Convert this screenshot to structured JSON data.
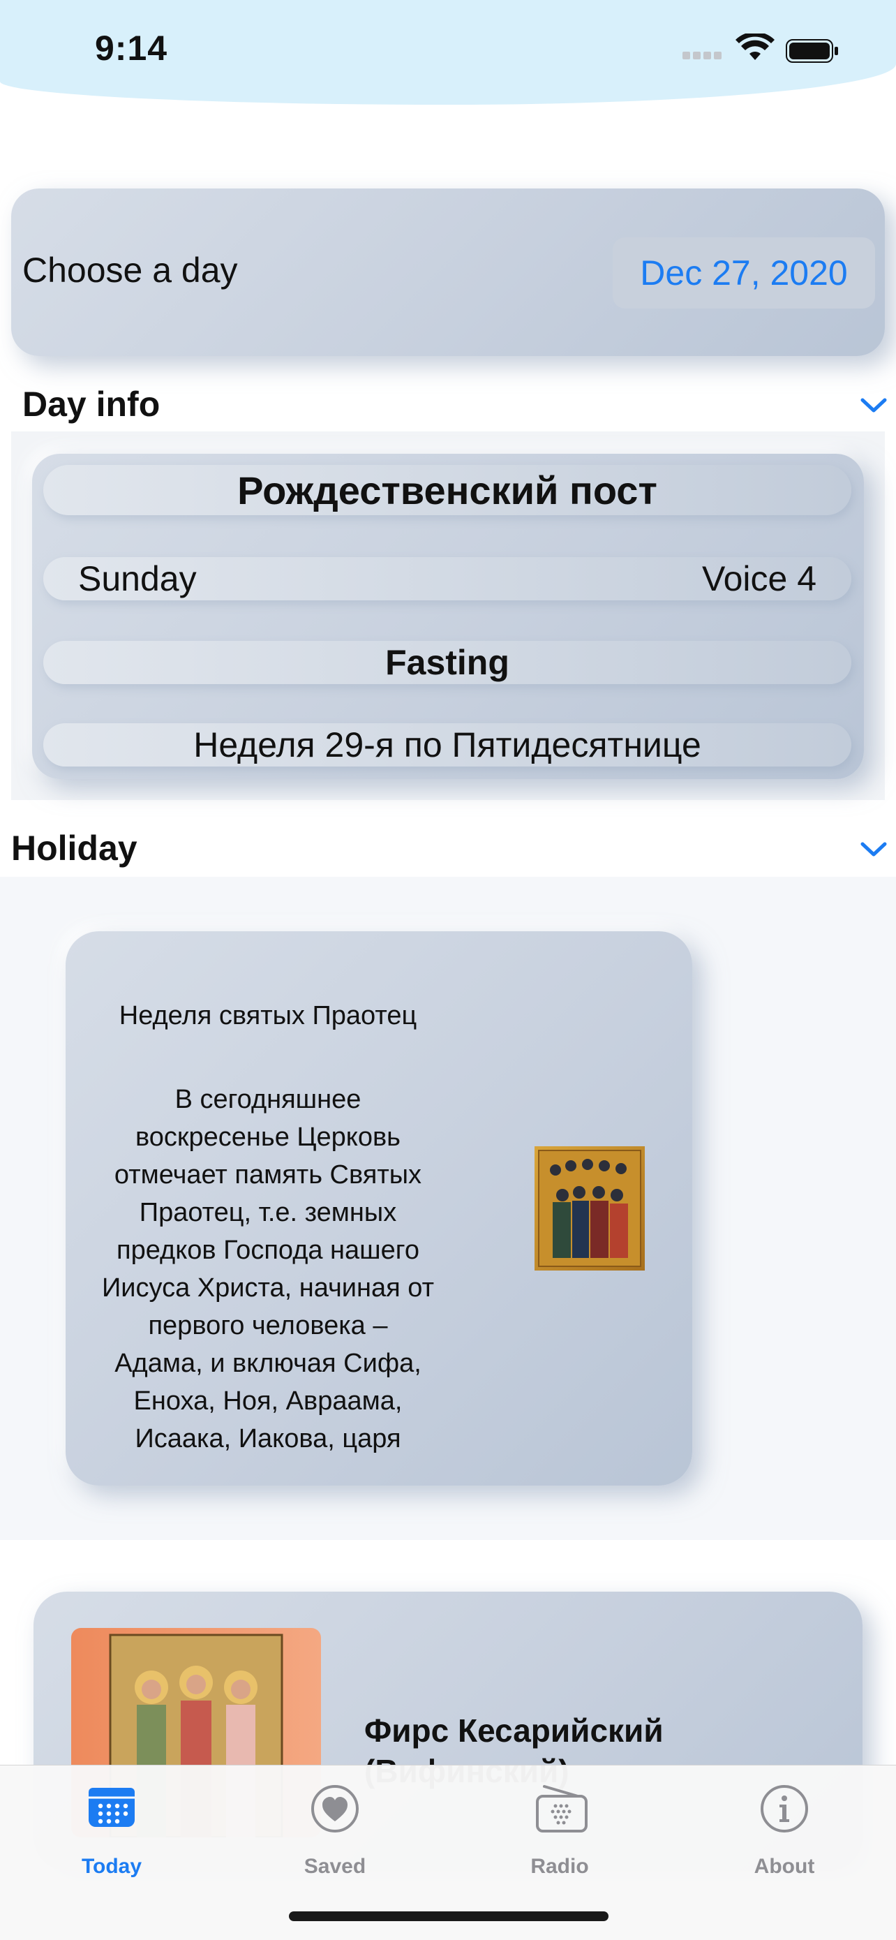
{
  "status": {
    "time": "9:14"
  },
  "chooser": {
    "label": "Choose a day",
    "date": "Dec 27, 2020"
  },
  "day_info": {
    "header": "Day info",
    "title": "Рождественский пост",
    "weekday": "Sunday",
    "voice": "Voice 4",
    "fasting": "Fasting",
    "week": "Неделя 29-я по Пятидесятнице"
  },
  "holiday": {
    "header": "Holiday",
    "card_title": "Неделя святых Праотец",
    "card_text": "В сегодняшнее воскресенье Церковь отмечает память Святых Праотец, т.е. земных предков Господа нашего Иисуса Христа, начиная от первого человека – Адама, и включая Сифа, Еноха, Ноя, Авраама, Исаака, Иакова, царя",
    "saint_name": "Фирс Кесарийский (Вифинский)"
  },
  "tabs": [
    {
      "label": "Today",
      "icon": "calendar-icon",
      "active": true
    },
    {
      "label": "Saved",
      "icon": "heart-icon",
      "active": false
    },
    {
      "label": "Radio",
      "icon": "radio-icon",
      "active": false
    },
    {
      "label": "About",
      "icon": "info-icon",
      "active": false
    }
  ],
  "colors": {
    "accent": "#1c7cf2",
    "inactive": "#8e8e93"
  }
}
